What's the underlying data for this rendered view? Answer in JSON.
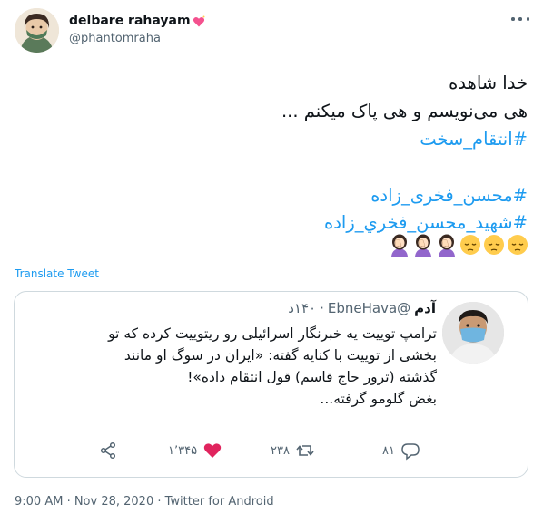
{
  "author": {
    "display_name": "delbare rahayam",
    "handle": "@phantomraha",
    "name_emoji": "sparkling-heart-icon"
  },
  "tweet": {
    "lines": [
      {
        "text": "خدا شاهده",
        "type": "text"
      },
      {
        "text": "هی می‌نویسم و هی پاک میکنم ...",
        "type": "text"
      },
      {
        "text": "#انتقام_سخت",
        "type": "hashtag"
      },
      {
        "text": "#محسن_فخری_زاده",
        "type": "hashtag"
      },
      {
        "text": "#شهید_محسن_فخري_زاده",
        "type": "hashtag"
      }
    ],
    "emojis": [
      "pensive-face-icon",
      "pensive-face-icon",
      "pensive-face-icon",
      "facepalm-woman-icon",
      "facepalm-woman-icon",
      "facepalm-woman-icon"
    ],
    "translate_label": "Translate Tweet"
  },
  "quote": {
    "name": "آدم",
    "handle": "@EbneHava",
    "separator": "·",
    "time": "۱۴۰د",
    "lines": [
      "ترامپ توییت یه خبرنگار اسرائیلی رو ریتوییت کرده که تو",
      "بخشی از توییت با کنایه گفته: «ایران در سوگ او مانند",
      "گذشته (ترور حاج قاسم) قول انتقام داده»!",
      "بغض گلومو گرفته..."
    ],
    "actions": {
      "reply_count": "۸۱",
      "retweet_count": "۲۳۸",
      "like_count": "۱٬۳۴۵",
      "like_color": "#e0245e"
    }
  },
  "footer": {
    "timestamp": "9:00 AM · Nov 28, 2020 · Twitter for Android"
  },
  "colors": {
    "link": "#1d9bf0",
    "secondary_text": "#536471",
    "border": "#cfd9de"
  }
}
